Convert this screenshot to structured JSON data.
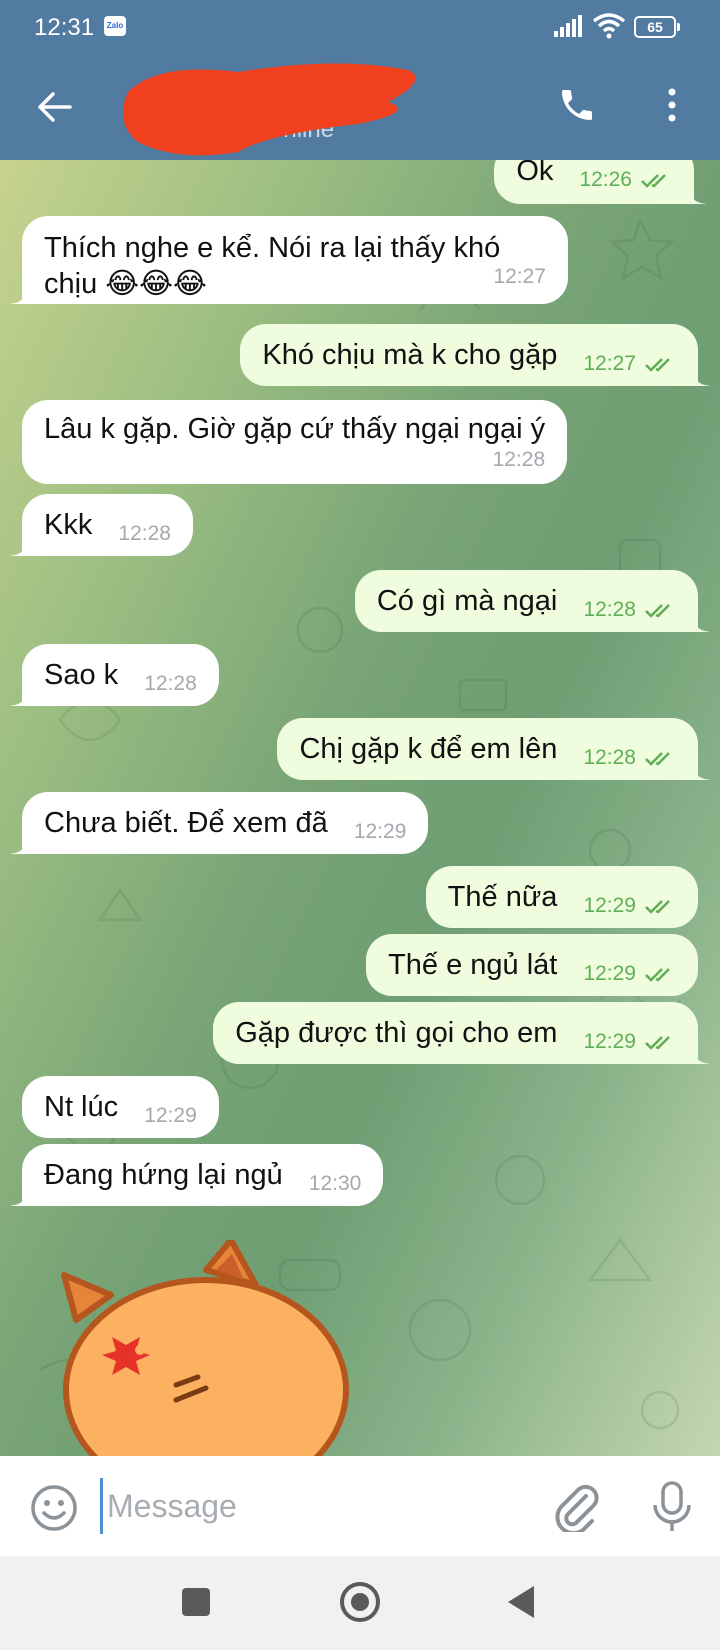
{
  "status_bar": {
    "time": "12:31",
    "app_badge": "Zalo",
    "battery": "65"
  },
  "header": {
    "contact_status": "online",
    "accent": "#527ba1"
  },
  "messages": [
    {
      "direction": "out",
      "text": "Ok",
      "time": "12:26",
      "read": true
    },
    {
      "direction": "in",
      "text": "Thích nghe e kể. Nói ra lại thấy khó chịu 😂😂😂",
      "time": "12:27"
    },
    {
      "direction": "out",
      "text": "Khó chịu mà k cho gặp",
      "time": "12:27",
      "read": true
    },
    {
      "direction": "in",
      "text": "Lâu k gặp. Giờ gặp cứ thấy ngại ngại ý",
      "time": "12:28"
    },
    {
      "direction": "in",
      "text": "Kkk",
      "time": "12:28"
    },
    {
      "direction": "out",
      "text": "Có gì mà ngại",
      "time": "12:28",
      "read": true
    },
    {
      "direction": "in",
      "text": "Sao k",
      "time": "12:28"
    },
    {
      "direction": "out",
      "text": "Chị gặp k để em lên",
      "time": "12:28",
      "read": true
    },
    {
      "direction": "in",
      "text": "Chưa biết. Để xem đã",
      "time": "12:29"
    },
    {
      "direction": "out",
      "text": "Thế nữa",
      "time": "12:29",
      "read": true
    },
    {
      "direction": "out",
      "text": "Thế e ngủ lát",
      "time": "12:29",
      "read": true
    },
    {
      "direction": "out",
      "text": "Gặp được thì gọi cho em",
      "time": "12:29",
      "read": true
    },
    {
      "direction": "in",
      "text": "Nt lúc",
      "time": "12:29"
    },
    {
      "direction": "in",
      "text": "Đang hứng lại ngủ",
      "time": "12:30"
    }
  ],
  "composer": {
    "placeholder": "Message",
    "value": ""
  },
  "icons": [
    "back-arrow-icon",
    "phone-icon",
    "more-vert-icon",
    "emoji-icon",
    "paperclip-icon",
    "microphone-icon",
    "double-check-icon",
    "angry-cat-sticker"
  ]
}
